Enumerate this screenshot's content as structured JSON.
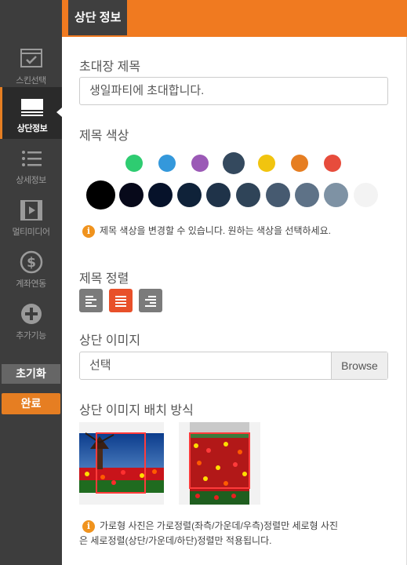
{
  "header": {
    "tab_label": "상단 정보"
  },
  "sidebar": {
    "items": [
      {
        "label": "스킨선택",
        "icon": "skin-select-icon"
      },
      {
        "label": "상단정보",
        "icon": "header-info-icon",
        "active": true
      },
      {
        "label": "상세정보",
        "icon": "detail-list-icon"
      },
      {
        "label": "멀티미디어",
        "icon": "multimedia-icon"
      },
      {
        "label": "계좌연동",
        "icon": "account-dollar-icon"
      },
      {
        "label": "추가기능",
        "icon": "add-feature-icon"
      }
    ],
    "reset_label": "초기화",
    "done_label": "완료"
  },
  "main": {
    "invite_title_label": "초대장 제목",
    "invite_title_value": "생일파티에 초대합니다.",
    "title_color_label": "제목 색상",
    "color_row1": [
      "#2ecc71",
      "#3498db",
      "#9b59b6",
      "#34495e",
      "#f1c40f",
      "#e67e22",
      "#e74c3c"
    ],
    "color_row2": [
      "#000000",
      "#07091a",
      "#06122a",
      "#0f2239",
      "#1f3349",
      "#2f4458",
      "#465a70",
      "#5e7287",
      "#7e92a4",
      "#f3f3f3"
    ],
    "color_info": "제목 색상을 변경할 수 있습니다. 원하는 색상을 선택하세요.",
    "title_align_label": "제목 정렬",
    "align_options": [
      "left",
      "center",
      "right"
    ],
    "align_selected": "center",
    "top_image_label": "상단 이미지",
    "top_image_value": "선택",
    "browse_label": "Browse",
    "image_layout_label": "상단 이미지 배치 방식",
    "image_info_line1": "가로형 사진은 가로정렬(좌측/가운데/우측)정렬만 세로형 사진",
    "image_info_line2": "은 세로정렬(상단/가운데/하단)정렬만 적용됩니다."
  }
}
